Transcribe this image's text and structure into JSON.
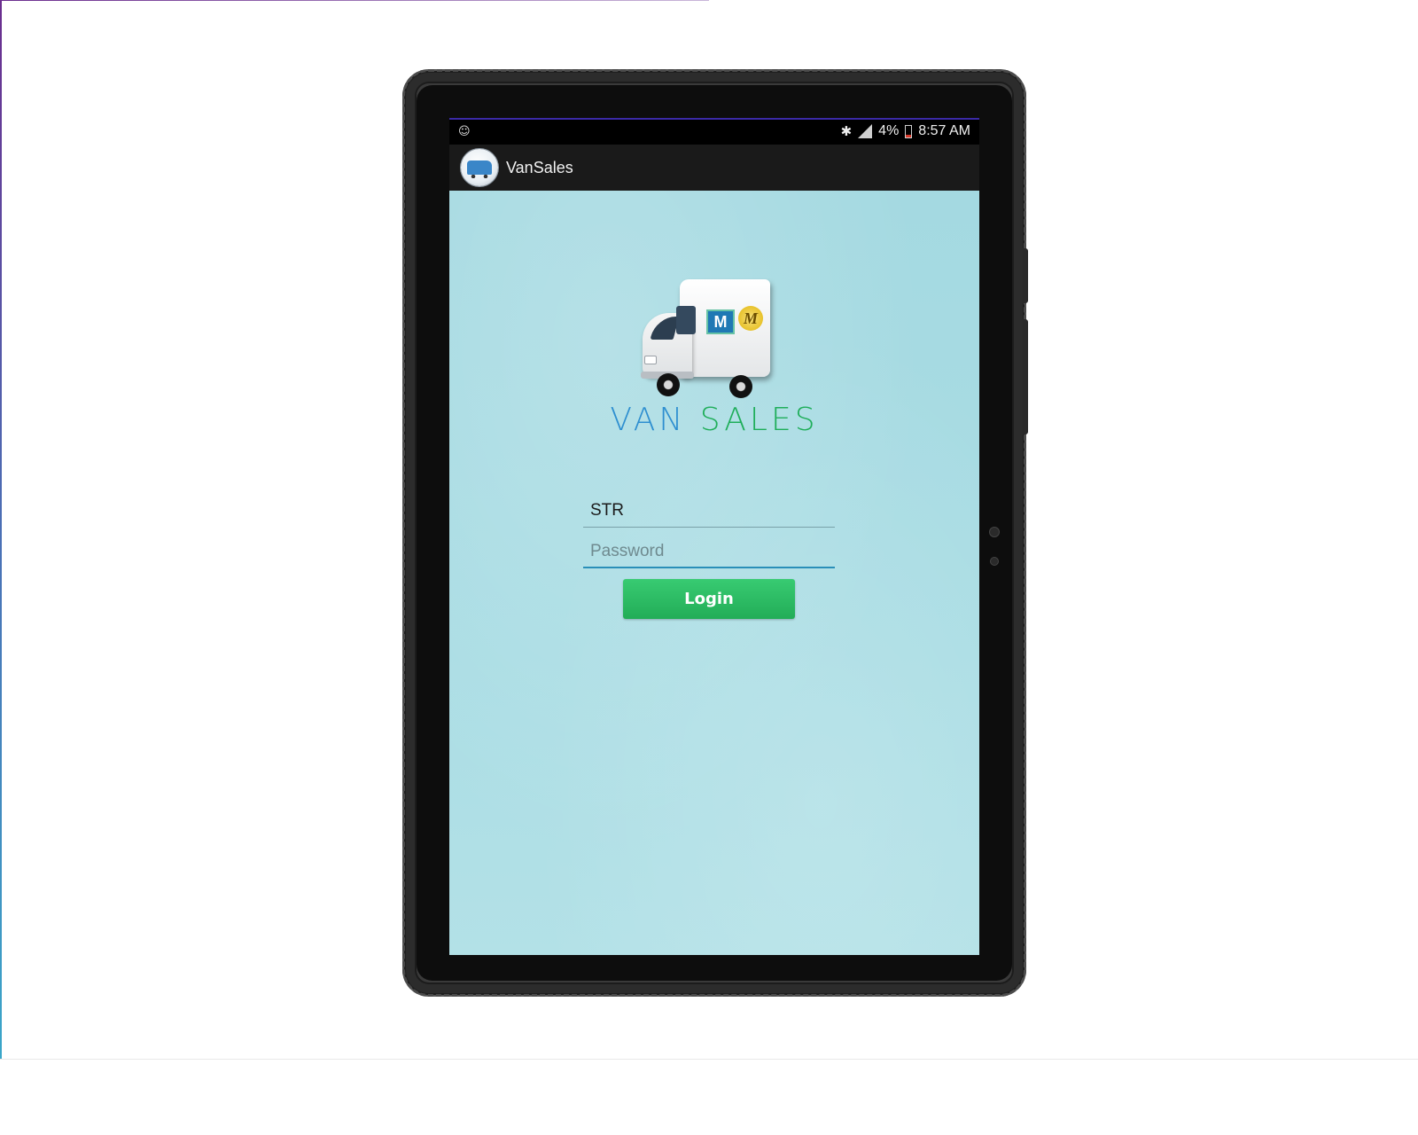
{
  "status_bar": {
    "left_icon": "android-debug-icon",
    "battery": "4%",
    "time": "8:57 AM",
    "icons": [
      "bluetooth-icon",
      "signal-icon",
      "battery-icon"
    ],
    "accent_color": "#3b2aa6"
  },
  "app_bar": {
    "title": "VanSales",
    "logo_icon": "van-logo-icon"
  },
  "splash": {
    "brand_part1": "VAN",
    "brand_part2": "SALES",
    "brand_part1_color": "#2e8fd0",
    "brand_part2_color": "#1fae5a",
    "van_logo_letter": "M",
    "van_logo_script": "M"
  },
  "login_form": {
    "username_value": "STR",
    "password_placeholder": "Password",
    "login_label": "Login",
    "button_color": "#22ad57"
  },
  "colors": {
    "screen_background": "#a9dce3",
    "app_bar_background": "#1a1a1a"
  }
}
